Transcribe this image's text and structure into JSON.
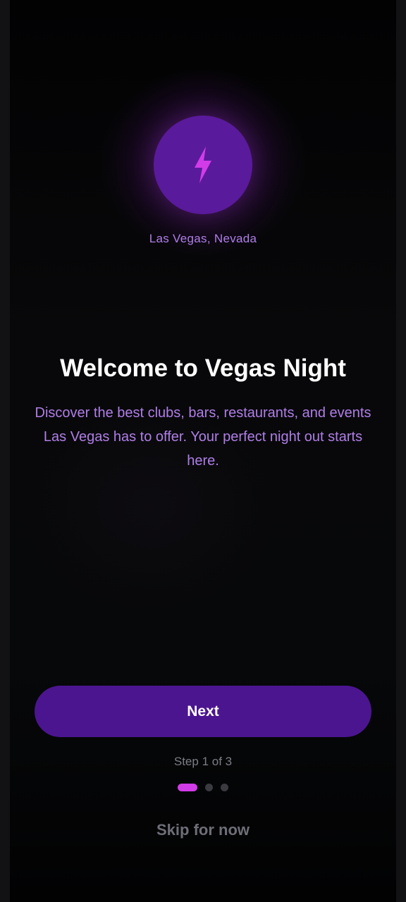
{
  "onboarding": {
    "location": "Las Vegas, Nevada",
    "title": "Welcome to Vegas Night",
    "description": "Discover the best clubs, bars, restaurants, and events Las Vegas has to offer. Your perfect night out starts here.",
    "next_label": "Next",
    "step_text": "Step 1 of 3",
    "skip_label": "Skip for now",
    "current_step": 1,
    "total_steps": 3,
    "logo_icon": "lightning-bolt-icon"
  },
  "colors": {
    "accent": "#d23ce8",
    "primary_button": "#4b1590",
    "logo_circle": "#5a1a9c",
    "text_purple": "#b07ee8",
    "background": "#020203"
  }
}
